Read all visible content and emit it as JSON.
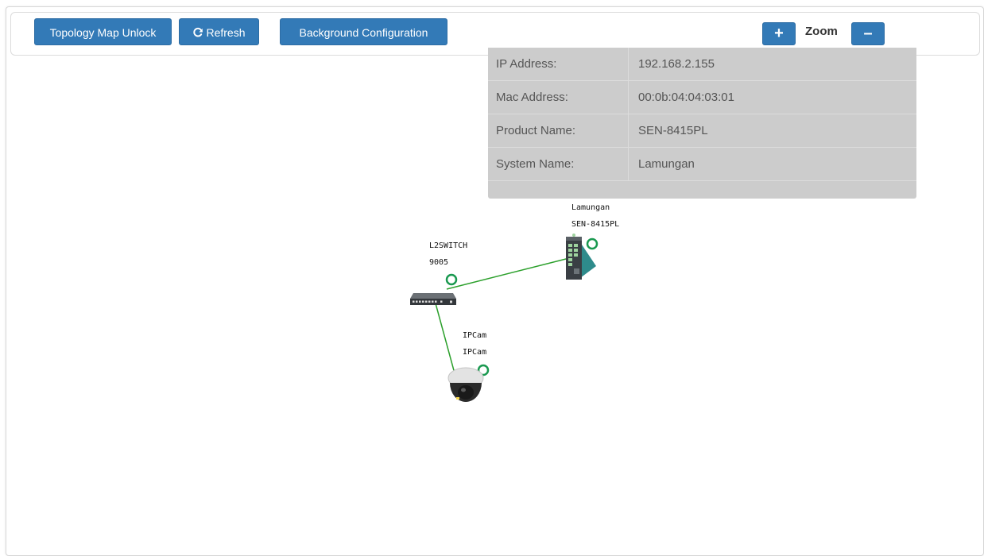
{
  "toolbar": {
    "unlock_label": "Topology Map Unlock",
    "refresh_label": "Refresh",
    "background_label": "Background Configuration",
    "zoom_in_label": "+",
    "zoom_label": "Zoom",
    "zoom_out_label": "–"
  },
  "info_panel": {
    "rows": [
      {
        "label": "IP Address:",
        "value": "192.168.2.155"
      },
      {
        "label": "Mac Address:",
        "value": "00:0b:04:04:03:01"
      },
      {
        "label": "Product Name:",
        "value": "SEN-8415PL"
      },
      {
        "label": "System Name:",
        "value": "Lamungan"
      }
    ]
  },
  "topology": {
    "nodes": [
      {
        "name": "Lamungan",
        "model": "SEN-8415PL",
        "icon": "industrial-switch-icon"
      },
      {
        "name": "L2SWITCH",
        "model": "9005",
        "icon": "desktop-switch-icon"
      },
      {
        "name": "IPCam",
        "model": "IPCam",
        "icon": "dome-camera-icon"
      }
    ],
    "link_color": "#2ca02c",
    "port_color": "#1a9950"
  },
  "colors": {
    "button": "#337ab7",
    "panel": "#cccccc"
  }
}
